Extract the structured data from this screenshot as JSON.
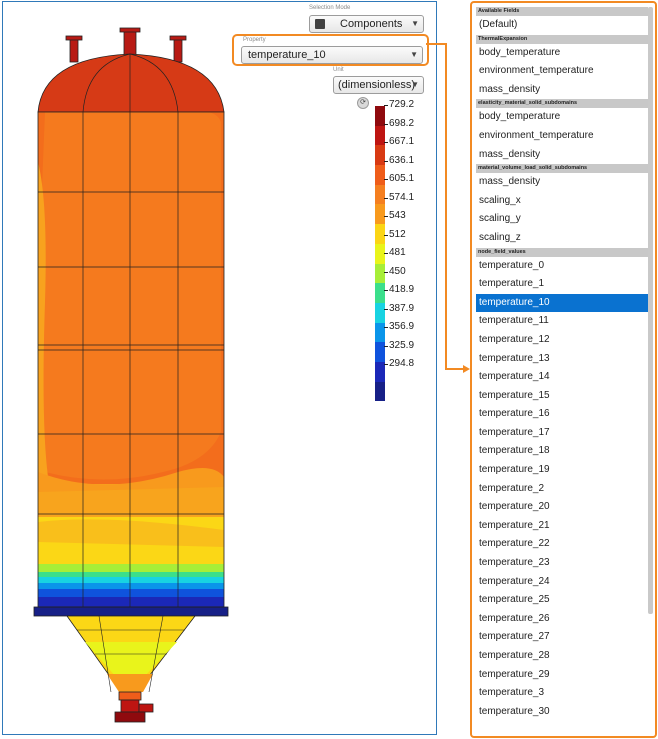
{
  "selection_mode": {
    "label": "Selection Mode",
    "value": "Components",
    "icon": "cube-icon"
  },
  "property": {
    "label": "Property",
    "value": "temperature_10"
  },
  "unit": {
    "label": "Unit",
    "value": "(dimensionless)"
  },
  "colors": {
    "accent": "#f28a23",
    "selection": "#0a72d0",
    "frame": "#2f79b9"
  },
  "legend": {
    "ticks": [
      "729.2",
      "698.2",
      "667.1",
      "636.1",
      "605.1",
      "574.1",
      "543",
      "512",
      "481",
      "450",
      "418.9",
      "387.9",
      "356.9",
      "325.9",
      "294.8"
    ],
    "colors": [
      "#8f0a0e",
      "#be1512",
      "#d83a13",
      "#ef5d1a",
      "#f57f20",
      "#f89a1d",
      "#fbd515",
      "#e9f41b",
      "#a7ee38",
      "#3bdf8b",
      "#18d3e2",
      "#0a95ea",
      "#0f53dd",
      "#1b28b8",
      "#172087"
    ]
  },
  "fields_panel": {
    "sections": [
      {
        "header": "Available Fields",
        "items": [
          "(Default)"
        ]
      },
      {
        "header": "ThermalExpansion",
        "items": [
          "body_temperature",
          "environment_temperature",
          "mass_density"
        ]
      },
      {
        "header": "elasticity_material_solid_subdomains",
        "items": [
          "body_temperature",
          "environment_temperature",
          "mass_density"
        ]
      },
      {
        "header": "material_volume_load_solid_subdomains",
        "items": [
          "mass_density",
          "scaling_x",
          "scaling_y",
          "scaling_z"
        ]
      },
      {
        "header": "node_field_values",
        "items": [
          "temperature_0",
          "temperature_1",
          "temperature_10",
          "temperature_11",
          "temperature_12",
          "temperature_13",
          "temperature_14",
          "temperature_15",
          "temperature_16",
          "temperature_17",
          "temperature_18",
          "temperature_19",
          "temperature_2",
          "temperature_20",
          "temperature_21",
          "temperature_22",
          "temperature_23",
          "temperature_24",
          "temperature_25",
          "temperature_26",
          "temperature_27",
          "temperature_28",
          "temperature_29",
          "temperature_3",
          "temperature_30"
        ]
      }
    ],
    "selected": "temperature_10"
  }
}
